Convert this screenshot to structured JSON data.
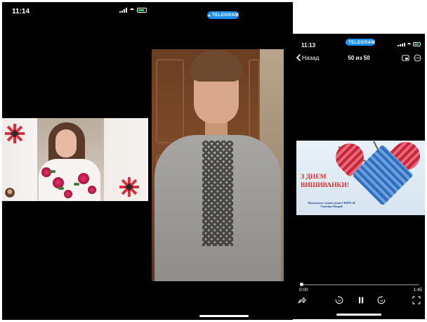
{
  "left_screen": {
    "status_time": "11:14",
    "telegram_badge": "TELEGRAM",
    "participants": [
      {
        "name": "girl-video",
        "avatar": "participant-avatar"
      },
      {
        "name": "boy-video"
      }
    ]
  },
  "right_screen": {
    "status_time": "11:13",
    "telegram_badge": "TELEGRAM",
    "back_label": "Назад",
    "counter": "50 из 50",
    "media": {
      "title_line1": "З ДНЕМ",
      "title_line2": "ВИШИВАНКИ!",
      "caption_line1": "Підготувала: студент групи 2-КНТБ-40",
      "caption_line2": "Савченко Назарій"
    },
    "playback": {
      "current_time": "0:00",
      "duration": "1:45",
      "progress": 0.01
    }
  },
  "colors": {
    "telegram_blue": "#1d8ef0",
    "battery_green": "#34c759",
    "title_red": "#d32b2b"
  },
  "icons": [
    "telegram-icon",
    "signal-icon",
    "wifi-icon",
    "battery-icon",
    "back-chevron-icon",
    "pip-icon",
    "more-icon",
    "share-icon",
    "rewind-15-icon",
    "pause-icon",
    "forward-15-icon",
    "fullscreen-icon"
  ]
}
